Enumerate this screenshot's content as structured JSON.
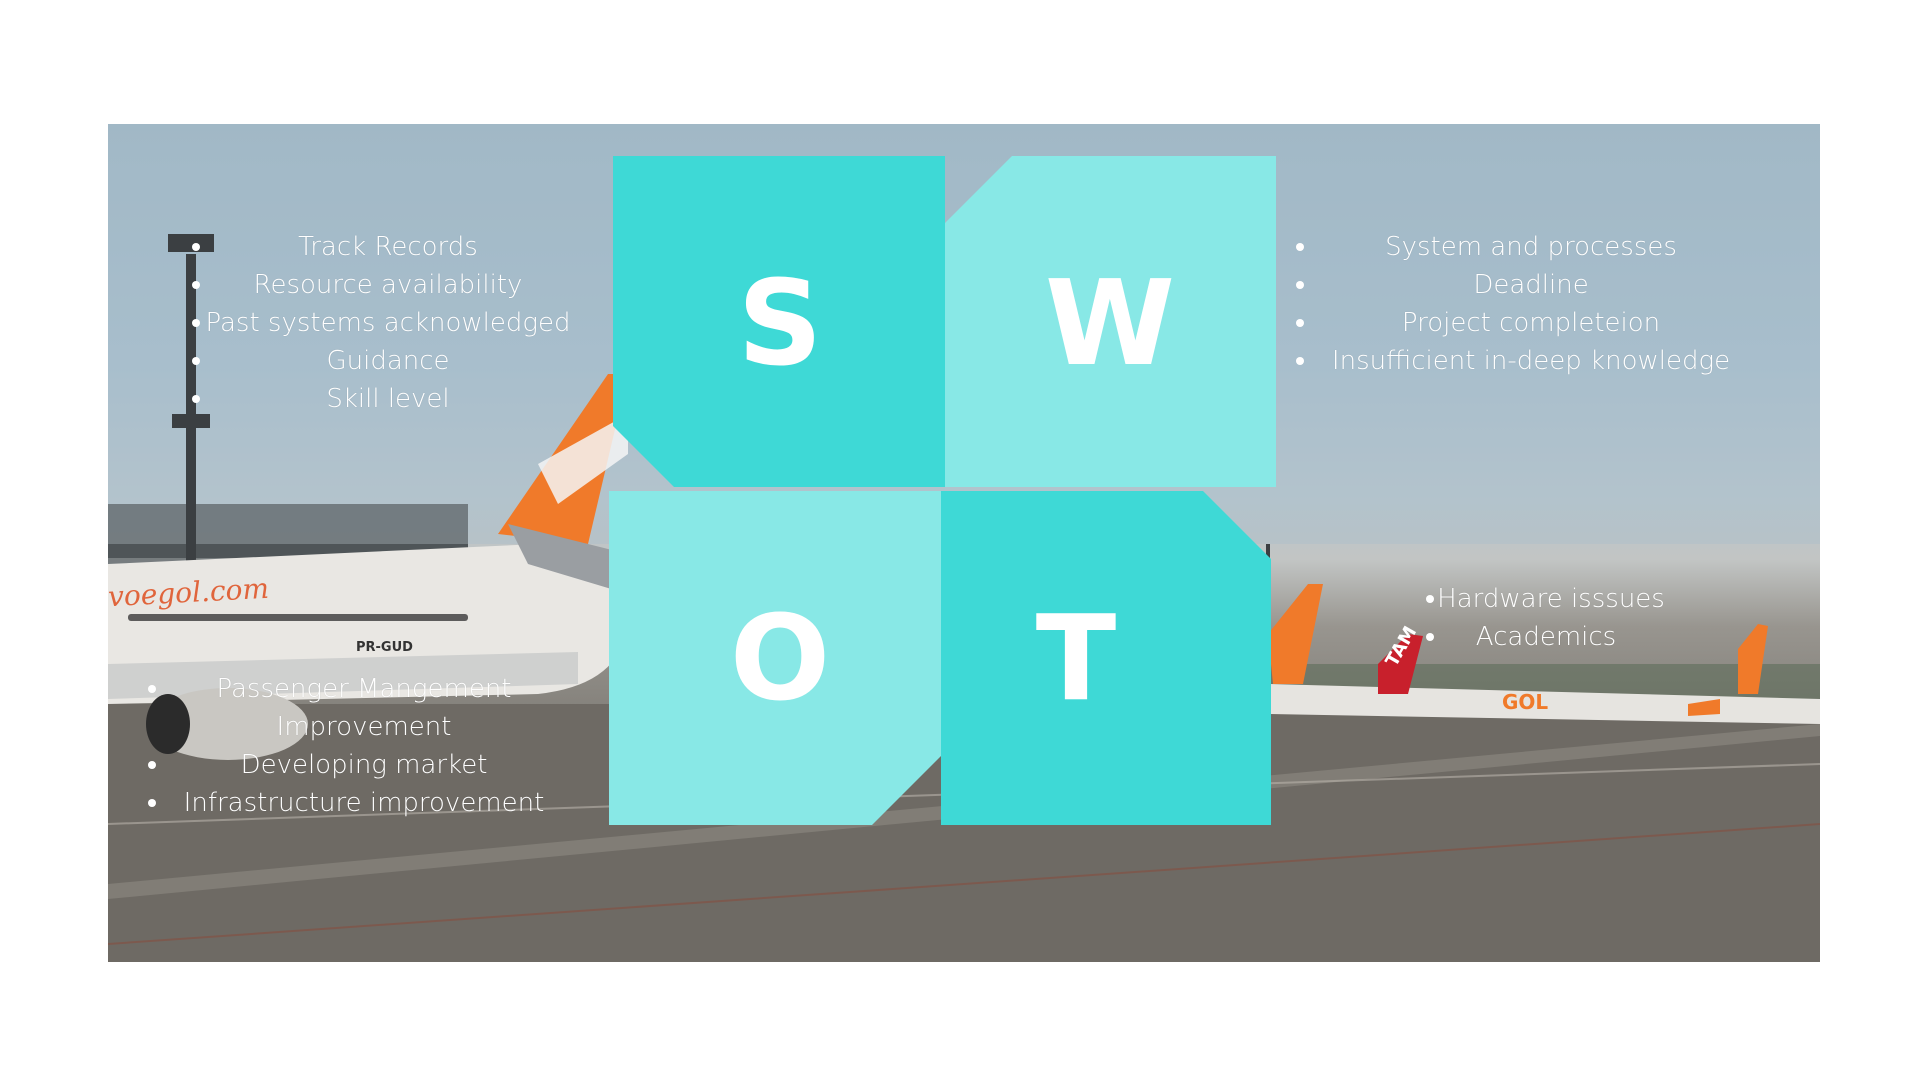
{
  "swot": {
    "s": {
      "letter": "S",
      "items": [
        "Track Records",
        "Resource availability",
        "Past systems acknowledged",
        "Guidance",
        "Skill level"
      ]
    },
    "w": {
      "letter": "W",
      "items": [
        "System and processes",
        "Deadline",
        "Project completeion",
        "Insufficient in-deep knowledge"
      ]
    },
    "o": {
      "letter": "O",
      "items": [
        "Passenger Mangement Improvement",
        "Developing market",
        "Infrastructure improvement"
      ]
    },
    "t": {
      "letter": "T",
      "items": [
        "Hardware isssues",
        "Academics"
      ]
    }
  },
  "colors": {
    "tile_dark": "#3ed9d6",
    "tile_light": "#88e8e6",
    "text": "#ffffff"
  },
  "background": {
    "aircraft_livery": "voegol.com",
    "registration": "PR-GUD",
    "tail_logo_1": "TAM",
    "tail_logo_2": "GOL"
  }
}
